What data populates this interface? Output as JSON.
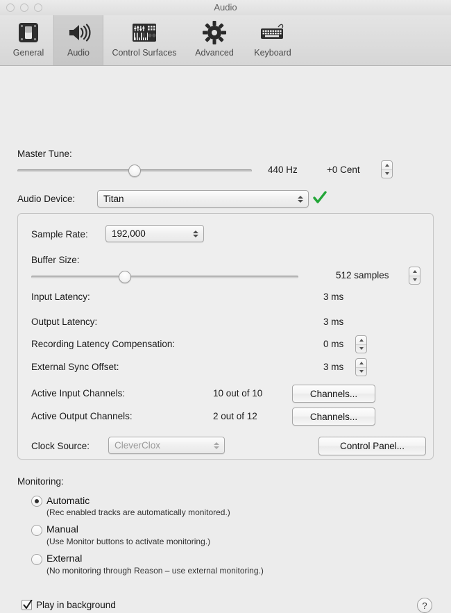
{
  "window": {
    "title": "Audio",
    "traffic_lights": [
      "close",
      "minimize",
      "zoom"
    ]
  },
  "toolbar": {
    "items": [
      {
        "label": "General",
        "icon": "general-icon",
        "selected": false
      },
      {
        "label": "Audio",
        "icon": "speaker-icon",
        "selected": true
      },
      {
        "label": "Control Surfaces",
        "icon": "keyboard-controller-icon",
        "selected": false
      },
      {
        "label": "Advanced",
        "icon": "gear-icon",
        "selected": false
      },
      {
        "label": "Keyboard",
        "icon": "computer-keyboard-icon",
        "selected": false
      }
    ]
  },
  "master_tune": {
    "label": "Master Tune:",
    "slider_percent": 50,
    "frequency": "440 Hz",
    "cent": "+0 Cent",
    "stepper": "cent-stepper"
  },
  "audio_device": {
    "label": "Audio Device:",
    "value": "Titan",
    "status_icon": "green-checkmark-icon",
    "status_color": "#23a638"
  },
  "device_panel": {
    "sample_rate": {
      "label": "Sample Rate:",
      "value": "192,000"
    },
    "buffer_size": {
      "label": "Buffer Size:",
      "slider_percent": 35,
      "value": "512 samples",
      "stepper": "buffer-size-stepper"
    },
    "latency_rows": [
      {
        "label": "Input Latency:",
        "value": "3 ms",
        "stepper": false
      },
      {
        "label": "Output Latency:",
        "value": "3 ms",
        "stepper": false
      },
      {
        "label": "Recording Latency Compensation:",
        "value": "0 ms",
        "stepper": true
      },
      {
        "label": "External Sync Offset:",
        "value": "3 ms",
        "stepper": true
      }
    ],
    "channel_rows": [
      {
        "label": "Active Input Channels:",
        "value": "10 out of 10",
        "button": "Channels..."
      },
      {
        "label": "Active Output Channels:",
        "value": "2 out of 12",
        "button": "Channels..."
      }
    ],
    "clock_source": {
      "label": "Clock Source:",
      "value": "CleverClox",
      "disabled": true
    },
    "control_panel_button": "Control Panel..."
  },
  "monitoring": {
    "label": "Monitoring:",
    "options": [
      {
        "title": "Automatic",
        "description": "(Rec enabled tracks are automatically monitored.)",
        "selected": true
      },
      {
        "title": "Manual",
        "description": "(Use Monitor buttons to activate monitoring.)",
        "selected": false
      },
      {
        "title": "External",
        "description": "(No monitoring through Reason – use external monitoring.)",
        "selected": false
      }
    ]
  },
  "footer": {
    "play_in_background": {
      "label": "Play in background",
      "checked": true
    },
    "help_label": "?"
  }
}
